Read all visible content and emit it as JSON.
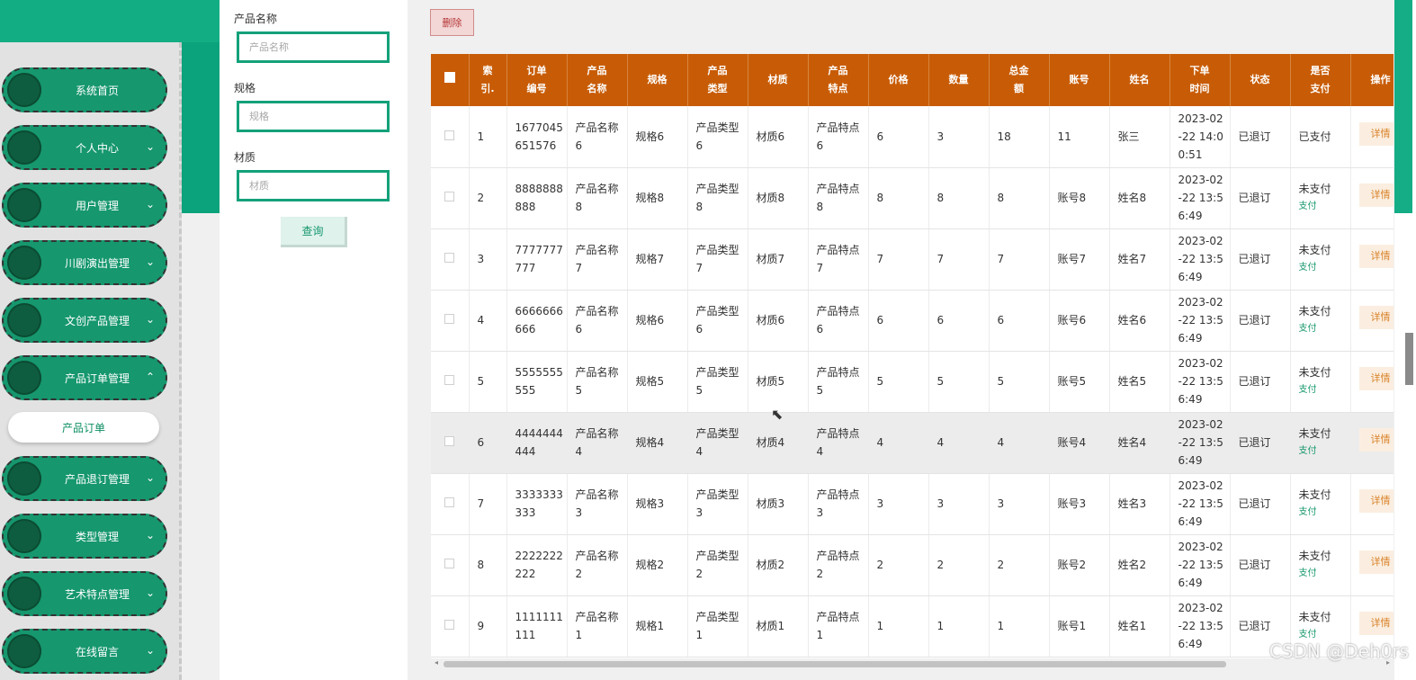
{
  "sidebar": {
    "items": [
      {
        "label": "系统首页",
        "chevron": ""
      },
      {
        "label": "个人中心",
        "chevron": "⌄"
      },
      {
        "label": "用户管理",
        "chevron": "⌄"
      },
      {
        "label": "川剧演出管理",
        "chevron": "⌄"
      },
      {
        "label": "文创产品管理",
        "chevron": "⌄"
      },
      {
        "label": "产品订单管理",
        "chevron": "⌃"
      },
      {
        "label": "产品退订管理",
        "chevron": "⌄"
      },
      {
        "label": "类型管理",
        "chevron": "⌄"
      },
      {
        "label": "艺术特点管理",
        "chevron": "⌄"
      },
      {
        "label": "在线留言",
        "chevron": "⌄"
      }
    ],
    "sub_item": "产品订单"
  },
  "search": {
    "name_label": "产品名称",
    "name_placeholder": "产品名称",
    "spec_label": "规格",
    "spec_placeholder": "规格",
    "material_label": "材质",
    "material_placeholder": "材质",
    "query_button": "查询"
  },
  "toolbar": {
    "delete_label": "删除"
  },
  "table": {
    "headers": [
      "索\n引.",
      "订单\n编号",
      "产品\n名称",
      "规格",
      "产品\n类型",
      "材质",
      "产品\n特点",
      "价格",
      "数量",
      "总金\n额",
      "账号",
      "姓名",
      "下单\n时间",
      "状态",
      "是否\n支付",
      "操作"
    ],
    "rows": [
      {
        "idx": "1",
        "order_no": "1677045\n651576",
        "name": "产品名称\n6",
        "spec": "规格6",
        "type": "产品类型\n6",
        "material": "材质6",
        "feature": "产品特点\n6",
        "price": "6",
        "qty": "3",
        "total": "18",
        "account": "11",
        "person": "张三",
        "time": "2023-02\n-22 14:0\n0:51",
        "status": "已退订",
        "paid": "已支付",
        "pay_link": "",
        "action": "详情"
      },
      {
        "idx": "2",
        "order_no": "8888888\n888",
        "name": "产品名称\n8",
        "spec": "规格8",
        "type": "产品类型\n8",
        "material": "材质8",
        "feature": "产品特点\n8",
        "price": "8",
        "qty": "8",
        "total": "8",
        "account": "账号8",
        "person": "姓名8",
        "time": "2023-02\n-22 13:5\n6:49",
        "status": "已退订",
        "paid": "未支付",
        "pay_link": "支付",
        "action": "详情"
      },
      {
        "idx": "3",
        "order_no": "7777777\n777",
        "name": "产品名称\n7",
        "spec": "规格7",
        "type": "产品类型\n7",
        "material": "材质7",
        "feature": "产品特点\n7",
        "price": "7",
        "qty": "7",
        "total": "7",
        "account": "账号7",
        "person": "姓名7",
        "time": "2023-02\n-22 13:5\n6:49",
        "status": "已退订",
        "paid": "未支付",
        "pay_link": "支付",
        "action": "详情"
      },
      {
        "idx": "4",
        "order_no": "6666666\n666",
        "name": "产品名称\n6",
        "spec": "规格6",
        "type": "产品类型\n6",
        "material": "材质6",
        "feature": "产品特点\n6",
        "price": "6",
        "qty": "6",
        "total": "6",
        "account": "账号6",
        "person": "姓名6",
        "time": "2023-02\n-22 13:5\n6:49",
        "status": "已退订",
        "paid": "未支付",
        "pay_link": "支付",
        "action": "详情"
      },
      {
        "idx": "5",
        "order_no": "5555555\n555",
        "name": "产品名称\n5",
        "spec": "规格5",
        "type": "产品类型\n5",
        "material": "材质5",
        "feature": "产品特点\n5",
        "price": "5",
        "qty": "5",
        "total": "5",
        "account": "账号5",
        "person": "姓名5",
        "time": "2023-02\n-22 13:5\n6:49",
        "status": "已退订",
        "paid": "未支付",
        "pay_link": "支付",
        "action": "详情"
      },
      {
        "idx": "6",
        "order_no": "4444444\n444",
        "name": "产品名称\n4",
        "spec": "规格4",
        "type": "产品类型\n4",
        "material": "材质4",
        "feature": "产品特点\n4",
        "price": "4",
        "qty": "4",
        "total": "4",
        "account": "账号4",
        "person": "姓名4",
        "time": "2023-02\n-22 13:5\n6:49",
        "status": "已退订",
        "paid": "未支付",
        "pay_link": "支付",
        "action": "详情"
      },
      {
        "idx": "7",
        "order_no": "3333333\n333",
        "name": "产品名称\n3",
        "spec": "规格3",
        "type": "产品类型\n3",
        "material": "材质3",
        "feature": "产品特点\n3",
        "price": "3",
        "qty": "3",
        "total": "3",
        "account": "账号3",
        "person": "姓名3",
        "time": "2023-02\n-22 13:5\n6:49",
        "status": "已退订",
        "paid": "未支付",
        "pay_link": "支付",
        "action": "详情"
      },
      {
        "idx": "8",
        "order_no": "2222222\n222",
        "name": "产品名称\n2",
        "spec": "规格2",
        "type": "产品类型\n2",
        "material": "材质2",
        "feature": "产品特点\n2",
        "price": "2",
        "qty": "2",
        "total": "2",
        "account": "账号2",
        "person": "姓名2",
        "time": "2023-02\n-22 13:5\n6:49",
        "status": "已退订",
        "paid": "未支付",
        "pay_link": "支付",
        "action": "详情"
      },
      {
        "idx": "9",
        "order_no": "1111111\n111",
        "name": "产品名称\n1",
        "spec": "规格1",
        "type": "产品类型\n1",
        "material": "材质1",
        "feature": "产品特点\n1",
        "price": "1",
        "qty": "1",
        "total": "1",
        "account": "账号1",
        "person": "姓名1",
        "time": "2023-02\n-22 13:5\n6:49",
        "status": "已退订",
        "paid": "未支付",
        "pay_link": "支付",
        "action": "详情"
      }
    ]
  },
  "watermark": "CSDN @Deh0rs",
  "colors": {
    "sidebar_green": "#16976e",
    "header_orange": "#c85c06",
    "accent": "#14a17a"
  }
}
